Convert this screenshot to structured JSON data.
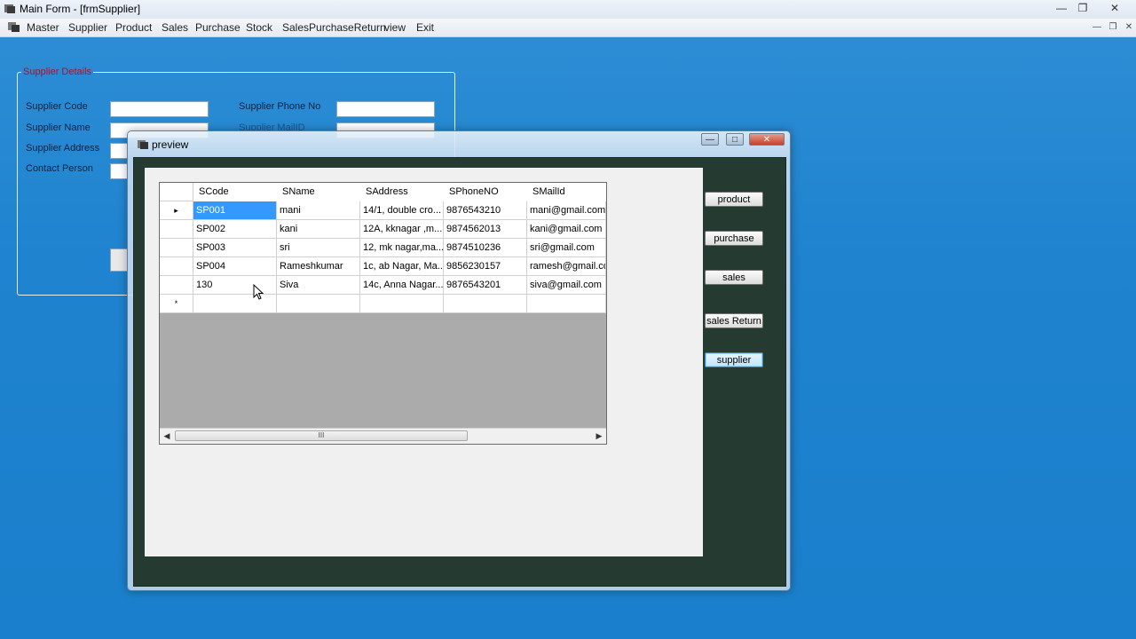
{
  "window": {
    "title": "Main Form - [frmSupplier]"
  },
  "menu": {
    "items": [
      "Master",
      "Supplier",
      "Product",
      "Sales",
      "Purchase",
      "Stock",
      "SalesPurchaseReturn",
      "view",
      "Exit"
    ]
  },
  "supplier_form": {
    "group_title": "Supplier Details",
    "labels": {
      "code": "Supplier Code",
      "name": "Supplier Name",
      "address": "Supplier Address",
      "contact": "Contact Person",
      "phone": "Supplier Phone No",
      "mail": "Supplier MailID"
    }
  },
  "preview": {
    "title": "preview",
    "grid": {
      "columns": [
        "SCode",
        "SName",
        "SAddress",
        "SPhoneNO",
        "SMailId"
      ],
      "rows": [
        [
          "SP001",
          "mani",
          "14/1, double cro...",
          "9876543210",
          "mani@gmail.com"
        ],
        [
          "SP002",
          "kani",
          "12A, kknagar ,m...",
          "9874562013",
          "kani@gmail.com"
        ],
        [
          "SP003",
          "sri",
          "12, mk nagar,ma...",
          "9874510236",
          "sri@gmail.com"
        ],
        [
          "SP004",
          "Rameshkumar",
          "1c, ab Nagar, Ma...",
          "9856230157",
          "ramesh@gmail.com"
        ],
        [
          "130",
          "Siva",
          "14c, Anna Nagar...",
          "9876543201",
          "siva@gmail.com"
        ]
      ],
      "new_row_marker": "*",
      "current_row_marker": "▸",
      "scroll_grip": "III"
    },
    "buttons": {
      "product": "product",
      "purchase": "purchase",
      "sales": "sales",
      "sales_return": "sales Return",
      "supplier": "supplier"
    }
  },
  "icons": {
    "app": "app-icon",
    "minimize": "minimize-icon",
    "maximize": "maximize-icon",
    "close": "close-icon",
    "cursor": "mouse-pointer-icon"
  },
  "colors": {
    "desktop": "#1f83cf",
    "selection": "#3399ff",
    "preview_client": "#253a30"
  }
}
